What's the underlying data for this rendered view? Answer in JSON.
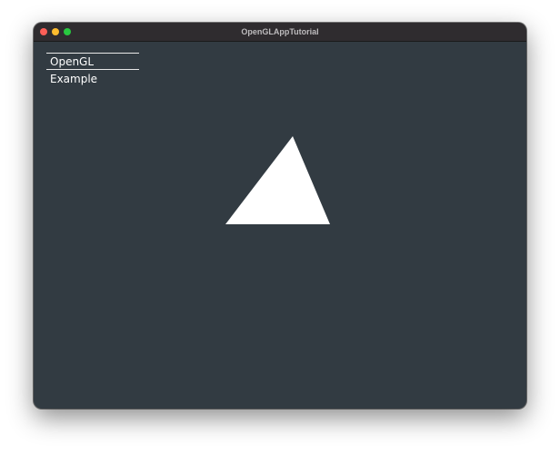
{
  "window": {
    "title": "OpenGLAppTutorial"
  },
  "overlay": {
    "label": "OpenGL Example"
  },
  "scene": {
    "background": "#323b42",
    "triangle_color": "#ffffff"
  }
}
